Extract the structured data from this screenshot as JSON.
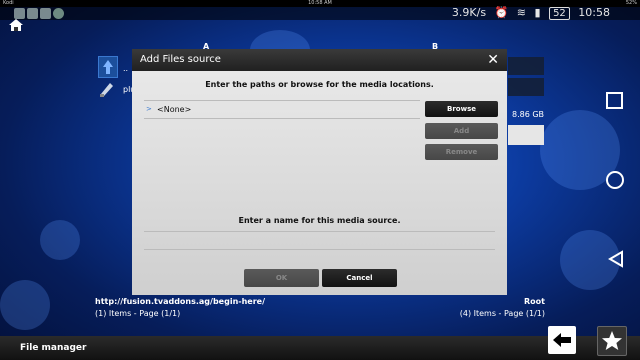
{
  "topstrip": {
    "app_name": "Kodi",
    "time_small": "10:58 AM",
    "battery_small": "52%"
  },
  "statusbar": {
    "speed": "3.9K/s",
    "battery": "52",
    "time": "10:58"
  },
  "panes": {
    "left_header": "A",
    "right_header": "B",
    "left_items": [
      ".. ",
      "plu"
    ],
    "right_size": "8.86 GB",
    "left_path": "http://fusion.tvaddons.ag/begin-here/",
    "left_count": "(1) Items - Page (1/1)",
    "right_path": "Root",
    "right_count": "(4) Items - Page (1/1)"
  },
  "dialog": {
    "title": "Add Files source",
    "close_glyph": "✕",
    "paths_heading": "Enter the paths or browse for the media locations.",
    "path_entries": [
      "<None>"
    ],
    "browse_label": "Browse",
    "add_label": "Add",
    "remove_label": "Remove",
    "name_heading": "Enter a name for this media source.",
    "ok_label": "OK",
    "cancel_label": "Cancel"
  },
  "bottombar": {
    "title": "File manager"
  },
  "icons": {
    "home": "home-icon",
    "back": "back-arrow-icon",
    "favourite": "star-icon",
    "nav_recent": "square-icon",
    "nav_home": "circle-icon",
    "nav_back": "triangle-back-icon"
  },
  "colors": {
    "accent": "#3a7ad0",
    "dialog_bg": "#dcdcdc",
    "button_dark": "#1e1e1e"
  }
}
